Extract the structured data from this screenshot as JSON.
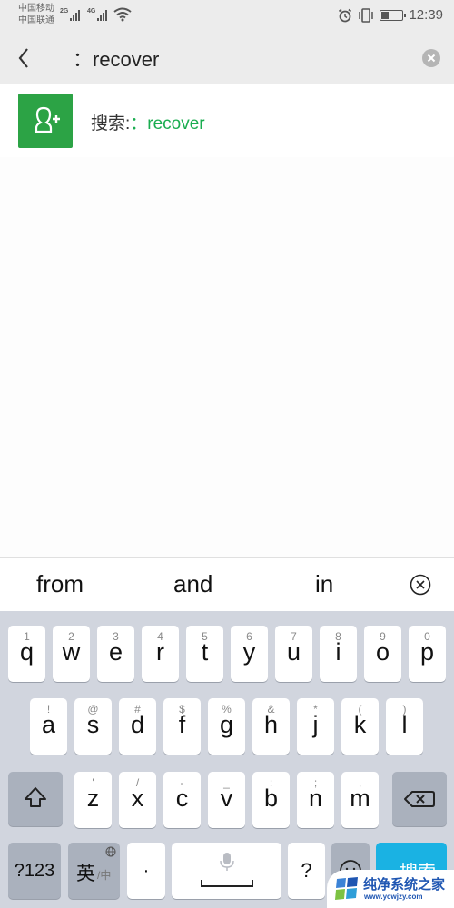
{
  "status_bar": {
    "carrier_1": "中国移动",
    "carrier_2": "中国联通",
    "signal_1_tag": "2G",
    "signal_2_tag": "4G",
    "time": "12:39",
    "battery_level": 0.3,
    "icons": [
      "signal-icon",
      "wifi-icon",
      "alarm-icon",
      "vibrate-icon",
      "battery-icon"
    ]
  },
  "search": {
    "back_icon": "chevron-left-icon",
    "query": "：recover",
    "clear_icon": "clear-circle-icon"
  },
  "results": [
    {
      "icon": "add-contact-icon",
      "prefix": "搜索:",
      "keyword": "：recover",
      "accent_color": "#1aad50"
    }
  ],
  "suggestions": {
    "items": [
      "from",
      "and",
      "in"
    ],
    "dismiss_icon": "close-circle-icon"
  },
  "keyboard": {
    "row1": [
      {
        "main": "q",
        "sub": "1"
      },
      {
        "main": "w",
        "sub": "2"
      },
      {
        "main": "e",
        "sub": "3"
      },
      {
        "main": "r",
        "sub": "4"
      },
      {
        "main": "t",
        "sub": "5"
      },
      {
        "main": "y",
        "sub": "6"
      },
      {
        "main": "u",
        "sub": "7"
      },
      {
        "main": "i",
        "sub": "8"
      },
      {
        "main": "o",
        "sub": "9"
      },
      {
        "main": "p",
        "sub": "0"
      }
    ],
    "row2": [
      {
        "main": "a",
        "sub": "!"
      },
      {
        "main": "s",
        "sub": "@"
      },
      {
        "main": "d",
        "sub": "#"
      },
      {
        "main": "f",
        "sub": "$"
      },
      {
        "main": "g",
        "sub": "%"
      },
      {
        "main": "h",
        "sub": "&"
      },
      {
        "main": "j",
        "sub": "*"
      },
      {
        "main": "k",
        "sub": "("
      },
      {
        "main": "l",
        "sub": ")"
      }
    ],
    "row3": [
      {
        "main": "z",
        "sub": "'"
      },
      {
        "main": "x",
        "sub": "/"
      },
      {
        "main": "c",
        "sub": "-"
      },
      {
        "main": "v",
        "sub": "_"
      },
      {
        "main": "b",
        "sub": ":"
      },
      {
        "main": "n",
        "sub": ";"
      },
      {
        "main": "m",
        "sub": ","
      }
    ],
    "shift_icon": "shift-icon",
    "backspace_icon": "backspace-icon",
    "numbers_label": "?123",
    "lang_main": "英",
    "lang_sub": "/中",
    "globe_icon": "globe-icon",
    "period_label": "·",
    "mic_icon": "microphone-icon",
    "question_label": "?",
    "emoji_icon": "emoji-icon",
    "search_label": "搜索"
  },
  "watermark": {
    "title": "纯净系统之家",
    "url": "www.ycwjzy.com"
  }
}
